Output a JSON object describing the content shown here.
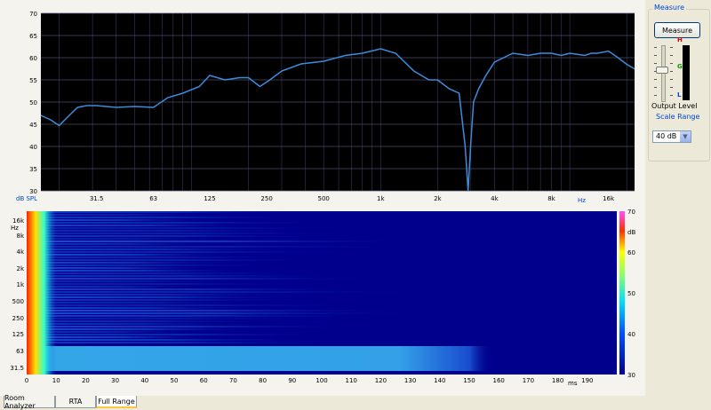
{
  "chart_data": [
    {
      "type": "line",
      "ylabel": "dB SPL",
      "xlabel": "Hz",
      "xscale": "log",
      "ylim": [
        30,
        70
      ],
      "xlim": [
        16,
        22000
      ],
      "yticks": [
        30,
        35,
        40,
        45,
        50,
        55,
        60,
        65,
        70
      ],
      "xticks": [
        {
          "v": 31.5,
          "label": "31.5"
        },
        {
          "v": 63,
          "label": "63"
        },
        {
          "v": 125,
          "label": "125"
        },
        {
          "v": 250,
          "label": "250"
        },
        {
          "v": 500,
          "label": "500"
        },
        {
          "v": 1000,
          "label": "1k"
        },
        {
          "v": 2000,
          "label": "2k"
        },
        {
          "v": 4000,
          "label": "4k"
        },
        {
          "v": 8000,
          "label": "8k"
        },
        {
          "v": 16000,
          "label": "16k"
        }
      ],
      "grid": true,
      "background": "#000000",
      "line_color": "#3c8cdc",
      "series": [
        {
          "x": [
            16,
            18,
            20,
            22,
            25,
            28,
            31.5,
            40,
            50,
            63,
            75,
            90,
            110,
            125,
            150,
            180,
            200,
            230,
            260,
            300,
            380,
            500,
            650,
            800,
            1000,
            1200,
            1500,
            1800,
            2000,
            2300,
            2600,
            2800,
            2900,
            3000,
            3100,
            3300,
            3600,
            4000,
            5000,
            6000,
            7000,
            8000,
            9000,
            10000,
            12000,
            13000,
            14000,
            16000,
            18000,
            20000,
            22000
          ],
          "y": [
            47,
            46,
            44.7,
            46.5,
            48.8,
            49.2,
            49.2,
            48.8,
            49,
            48.8,
            51,
            52,
            53.5,
            56,
            55,
            55.5,
            55.5,
            53.5,
            55,
            57,
            58.6,
            59.2,
            60.5,
            61,
            62,
            61,
            57,
            55,
            55,
            53,
            52,
            40,
            30,
            41,
            50,
            53,
            56,
            59,
            61,
            60.5,
            61,
            61,
            60.5,
            61,
            60.5,
            61,
            61,
            61.5,
            60,
            58.5,
            57.5
          ]
        }
      ]
    },
    {
      "type": "heatmap",
      "xlabel": "ms",
      "ylabel": "Hz",
      "colorbar_label": "dB",
      "xlim": [
        0,
        200
      ],
      "xticks": [
        0,
        10,
        20,
        30,
        40,
        50,
        60,
        70,
        80,
        90,
        100,
        110,
        120,
        130,
        140,
        150,
        160,
        170,
        180,
        190
      ],
      "yticks": [
        "16k",
        "Hz",
        "8k",
        "4k",
        "2k",
        "1k",
        "500",
        "250",
        "125",
        "63",
        "31.5"
      ],
      "colorbar_ticks": [
        70,
        60,
        50,
        40,
        30
      ],
      "colorbar_range": [
        30,
        70
      ]
    }
  ],
  "right_panel": {
    "measure_group_title": "Measure",
    "measure_button": "Measure",
    "meter_top_letter": "H",
    "meter_mid_letter": "G",
    "meter_bottom_letter": "L",
    "output_level_label": "Output Level",
    "scale_range_label": "Scale Range",
    "scale_range_value": "40 dB",
    "output_level": 0.55
  },
  "tabs": [
    "Room Analyzer",
    "RTA",
    "Full Range"
  ],
  "active_tab": "Full Range"
}
